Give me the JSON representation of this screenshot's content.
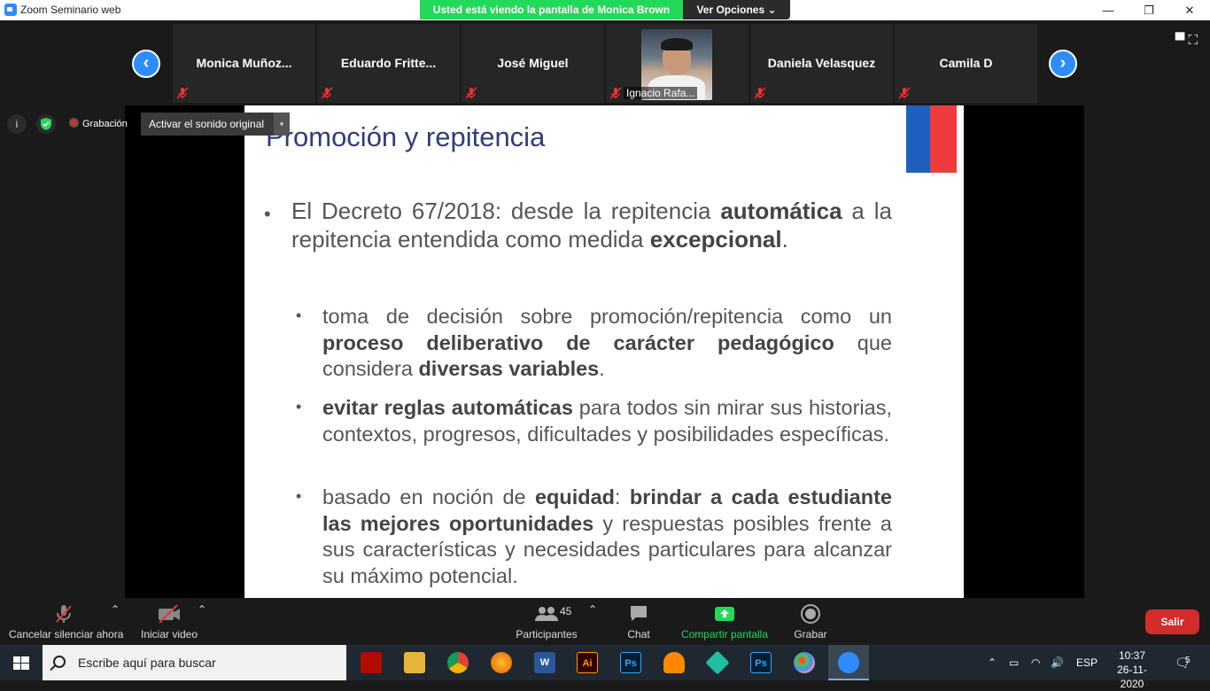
{
  "window": {
    "title": "Zoom Seminario web",
    "minimize": "—",
    "restore": "❐",
    "close": "✕"
  },
  "share_banner": {
    "text": "Usted está viendo la pantalla de  Monica Brown",
    "options_label": "Ver Opciones ⌄"
  },
  "gallery": {
    "prev_arrow": "‹",
    "next_arrow": "›",
    "participants": [
      {
        "name": "Monica  Muñoz..."
      },
      {
        "name": "Eduardo  Fritte..."
      },
      {
        "name": "José  Miguel"
      },
      {
        "name": "Ignacio Rafa..."
      },
      {
        "name": "Daniela Velasquez"
      },
      {
        "name": "Camila D"
      }
    ],
    "view_icons": "▀ ⛶"
  },
  "meeting_info": {
    "info_icon": "i",
    "recording_label": "Grabación",
    "original_sound_label": "Activar el sonido original",
    "dropdown_caret": "▾"
  },
  "slide": {
    "title": "Promoción y repitencia",
    "bullet_dot": "•",
    "main_bullet": {
      "t1": "El Decreto 67/2018: desde la repitencia ",
      "b1": "automática",
      "t2": " a la repitencia entendida como medida ",
      "b2": "excepcional",
      "t3": "."
    },
    "sub_bullets": [
      {
        "t1": "toma de decisión sobre promoción/repitencia como un ",
        "b1": "proceso deliberativo de carácter pedagógico",
        "t2": " que considera ",
        "b2": "diversas variables",
        "t3": "."
      },
      {
        "t1": "",
        "b1": "evitar reglas automáticas",
        "t2": " para todos sin mirar sus historias, contextos, progresos, dificultades y posibilidades específicas.",
        "b2": "",
        "t3": ""
      },
      {
        "t1": "basado en noción de ",
        "b1": "equidad",
        "t2": ": ",
        "b2": "brindar a cada estudiante las mejores oportunidades",
        "t3": " y respuestas posibles frente a sus características y necesidades particulares para alcanzar su máximo potencial."
      }
    ]
  },
  "toolbar": {
    "mute_label": "Cancelar silenciar ahora",
    "video_label": "Iniciar video",
    "caret": "⌃",
    "participants_label": "Participantes",
    "participants_count": "45",
    "chat_label": "Chat",
    "share_label": "Compartir pantalla",
    "record_label": "Grabar",
    "leave_label": "Salir"
  },
  "taskbar": {
    "search_placeholder": "Escribe aquí para buscar",
    "apps": [
      "acrobat",
      "explorer",
      "chrome",
      "firefox",
      "word",
      "illustrator",
      "photoshop",
      "vlc",
      "filmora",
      "photoshop2",
      "paint",
      "zoom"
    ],
    "ai_label": "Ai",
    "ps_label": "Ps",
    "word_label": "W",
    "language": "ESP",
    "time": "10:37",
    "date": "26-11-2020",
    "notifications": "5"
  },
  "colors": {
    "zoom_blue": "#2d8cff",
    "share_green": "#23d959",
    "leave_red": "#d42b2b",
    "slide_title": "#2f3d79"
  }
}
